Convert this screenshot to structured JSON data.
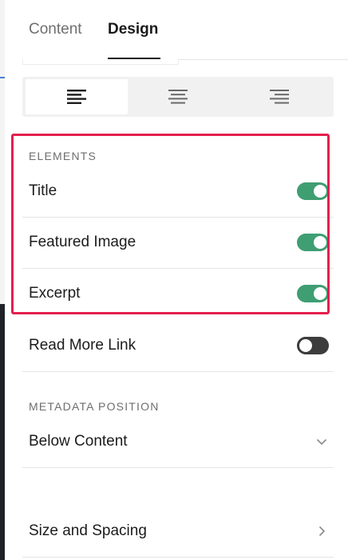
{
  "tabs": {
    "content": "Content",
    "design": "Design",
    "active": "Design"
  },
  "alignment": {
    "options": [
      "left-align-icon",
      "center-align-icon",
      "right-align-icon"
    ],
    "selected": "left"
  },
  "elements": {
    "heading": "ELEMENTS",
    "items": [
      {
        "label": "Title",
        "enabled": true
      },
      {
        "label": "Featured Image",
        "enabled": true
      },
      {
        "label": "Excerpt",
        "enabled": true
      },
      {
        "label": "Read More Link",
        "enabled": false
      }
    ]
  },
  "metadata": {
    "heading": "METADATA POSITION",
    "value": "Below Content"
  },
  "size_spacing": {
    "label": "Size and Spacing"
  },
  "colors": {
    "toggle_on": "#3f9e72",
    "toggle_off": "#3c3c3c",
    "highlight": "#e3204e"
  }
}
